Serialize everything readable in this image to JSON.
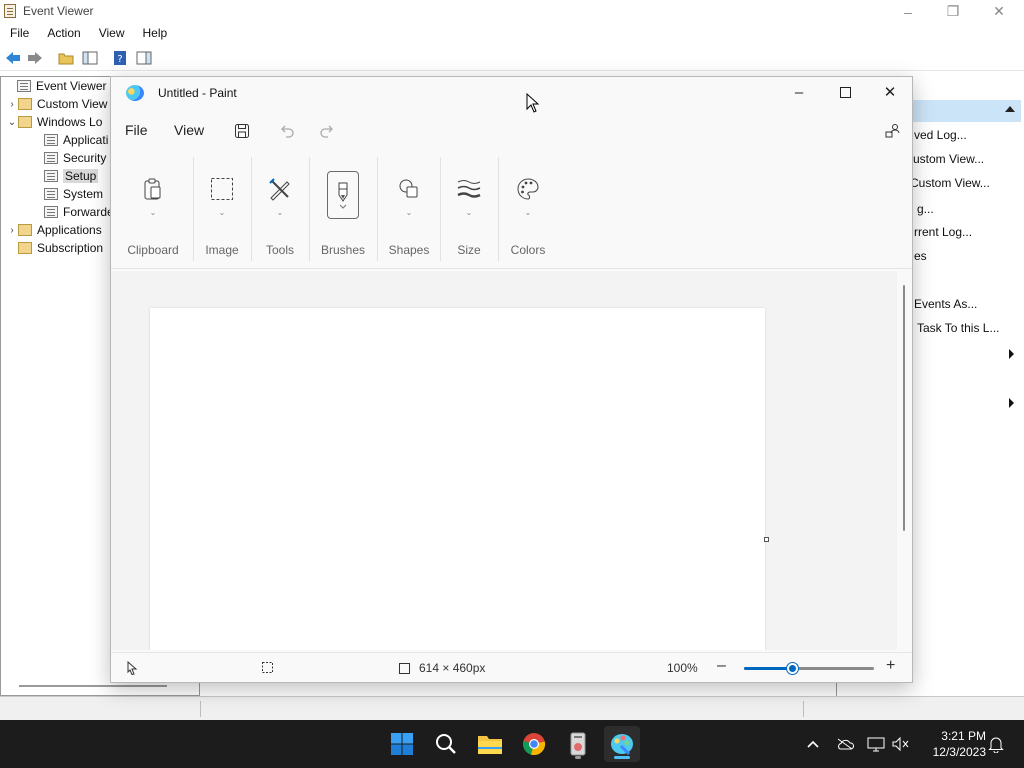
{
  "event_viewer": {
    "title": "Event Viewer",
    "menu": [
      "File",
      "Action",
      "View",
      "Help"
    ],
    "tree": [
      {
        "label": "Event Viewer (Lo",
        "level": 0,
        "expander": "",
        "icon": "event-viewer"
      },
      {
        "label": "Custom View",
        "level": 1,
        "expander": "›",
        "icon": "folder"
      },
      {
        "label": "Windows Lo",
        "level": 1,
        "expander": "⌄",
        "icon": "folder"
      },
      {
        "label": "Applicati",
        "level": 2,
        "expander": "",
        "icon": "log"
      },
      {
        "label": "Security",
        "level": 2,
        "expander": "",
        "icon": "log"
      },
      {
        "label": "Setup",
        "level": 2,
        "expander": "",
        "icon": "log",
        "selected": true
      },
      {
        "label": "System",
        "level": 2,
        "expander": "",
        "icon": "log"
      },
      {
        "label": "Forwarde",
        "level": 2,
        "expander": "",
        "icon": "log"
      },
      {
        "label": "Applications",
        "level": 1,
        "expander": "›",
        "icon": "folder"
      },
      {
        "label": "Subscription",
        "level": 1,
        "expander": "",
        "icon": "folder"
      }
    ],
    "actions": [
      "ved Log...",
      "ustom View...",
      "Custom View...",
      "g...",
      "rrent Log...",
      "es",
      "Events As...",
      "Task To this L..."
    ]
  },
  "paint": {
    "title": "Untitled - Paint",
    "menu": {
      "file": "File",
      "view": "View"
    },
    "ribbon": [
      {
        "label": "Clipboard",
        "icon": "clipboard-icon"
      },
      {
        "label": "Image",
        "icon": "select-rectangle-icon"
      },
      {
        "label": "Tools",
        "icon": "tools-icon"
      },
      {
        "label": "Brushes",
        "icon": "brush-icon"
      },
      {
        "label": "Shapes",
        "icon": "shapes-icon"
      },
      {
        "label": "Size",
        "icon": "stroke-size-icon"
      },
      {
        "label": "Colors",
        "icon": "palette-icon"
      }
    ],
    "status": {
      "canvas_size": "614 × 460px",
      "zoom": "100%",
      "zoom_fraction": 0.38
    }
  },
  "taskbar": {
    "apps": [
      "start",
      "search",
      "file-explorer",
      "chrome",
      "event-viewer",
      "paint"
    ],
    "time": "3:21 PM",
    "date": "12/3/2023"
  },
  "colors": {
    "accent": "#0067c0",
    "taskbar": "#1c1c1c",
    "selection": "#cce4f7"
  }
}
